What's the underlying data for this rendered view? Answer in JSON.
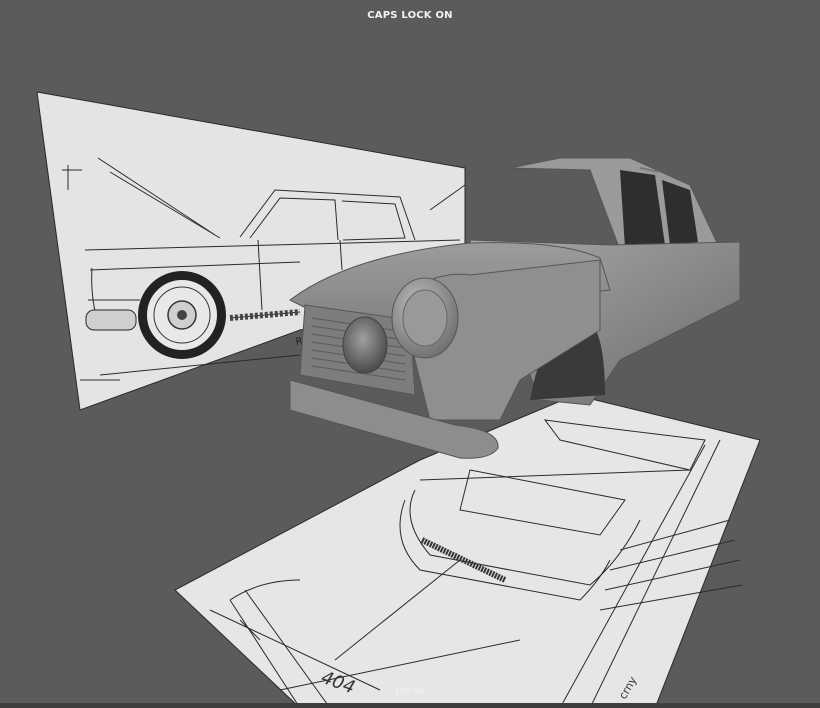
{
  "viewport": {
    "status_text": "CAPS LOCK ON",
    "camera_label": "persp",
    "background_color": "#5b5b5b"
  },
  "scene": {
    "objects": [
      {
        "name": "side-blueprint-plane",
        "kind": "image-plane"
      },
      {
        "name": "top-blueprint-plane",
        "kind": "image-plane"
      },
      {
        "name": "car-body-mesh",
        "kind": "mesh"
      }
    ]
  }
}
